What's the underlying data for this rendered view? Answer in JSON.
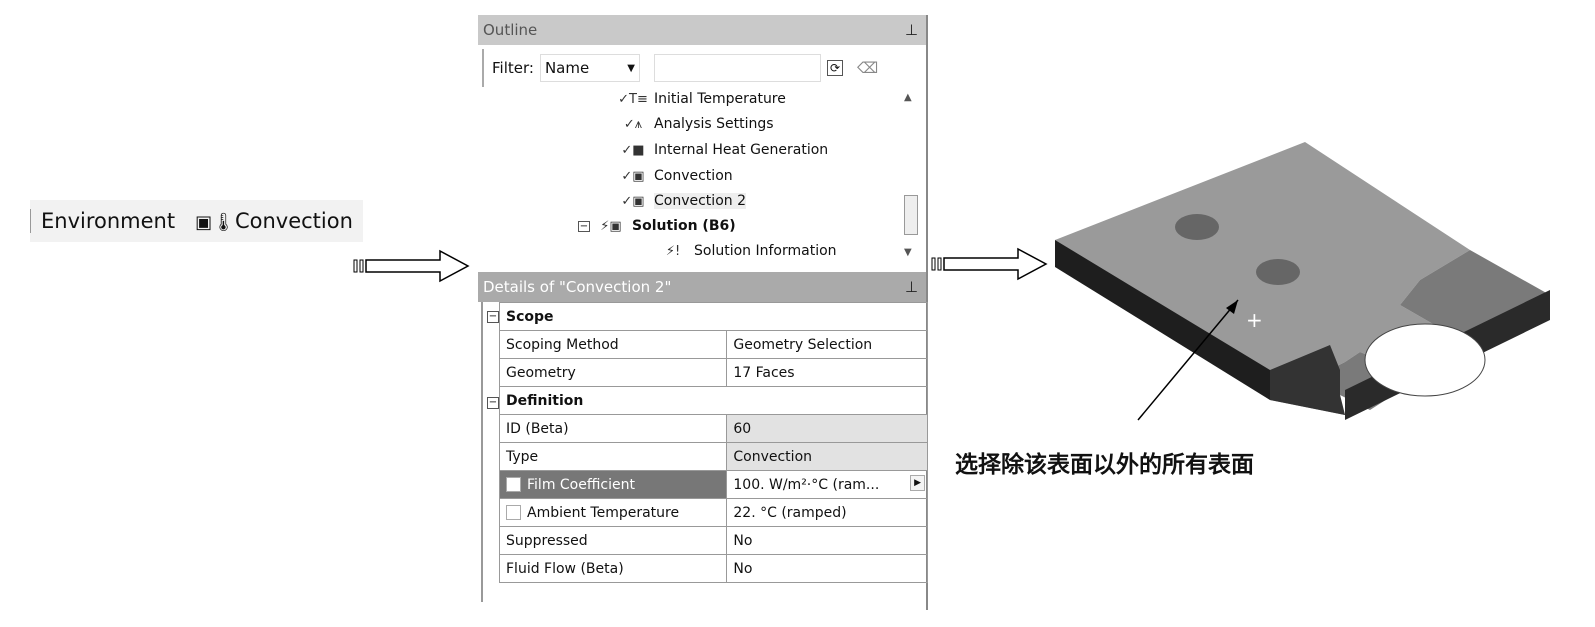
{
  "toolbar": {
    "environment": "Environment",
    "convection": "Convection",
    "convection_icon": "convection-icon"
  },
  "outline": {
    "title": "Outline",
    "filter_label": "Filter:",
    "filter_value": "Name",
    "search_value": "",
    "tree": [
      {
        "label": "Initial Temperature",
        "icon": "initial-temperature-icon"
      },
      {
        "label": "Analysis Settings",
        "icon": "analysis-settings-icon"
      },
      {
        "label": "Internal Heat Generation",
        "icon": "heat-generation-icon"
      },
      {
        "label": "Convection",
        "icon": "convection-icon"
      },
      {
        "label": "Convection 2",
        "icon": "convection-icon",
        "selected": true
      },
      {
        "label": "Solution (B6)",
        "icon": "solution-icon",
        "bold": true
      },
      {
        "label": "Solution Information",
        "icon": "solution-information-icon"
      }
    ]
  },
  "details": {
    "title": "Details of \"Convection 2\"",
    "groups": {
      "scope": "Scope",
      "definition": "Definition"
    },
    "rows": [
      {
        "label": "Scoping Method",
        "value": "Geometry Selection"
      },
      {
        "label": "Geometry",
        "value": "17 Faces"
      },
      {
        "label": "ID (Beta)",
        "value": "60"
      },
      {
        "label": "Type",
        "value": "Convection"
      },
      {
        "label": "Film Coefficient",
        "value": "100. W/m²·°C  (ram..."
      },
      {
        "label": "Ambient Temperature",
        "value": "22. °C  (ramped)"
      },
      {
        "label": "Suppressed",
        "value": "No"
      },
      {
        "label": "Fluid Flow (Beta)",
        "value": "No"
      }
    ]
  },
  "annotation": "选择除该表面以外的所有表面"
}
